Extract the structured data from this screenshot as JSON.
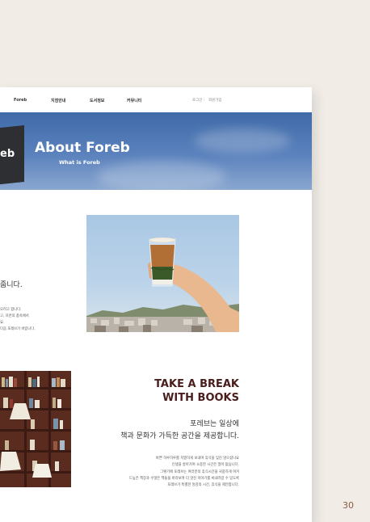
{
  "nav": {
    "items": [
      "Foreb",
      "지점안내",
      "도서정보",
      "커뮤니티"
    ],
    "login": "로그인",
    "signup": "회원가입"
  },
  "hero": {
    "sign_text": "eb",
    "title": "About Foreb",
    "subtitle": "What is Foreb"
  },
  "intro": {
    "heading_fragment": "줍니다.",
    "body_fragments": [
      "오려고 합니다.",
      "고, 자연의 품속에서",
      "요.",
      "다음 포레브가 바랍니다."
    ]
  },
  "break_section": {
    "title_line1": "TAKE A BREAK",
    "title_line2": "WITH BOOKS",
    "lead_line1": "포레브는 일상에",
    "lead_line2": "책과 문화가 가득한 공간을 제공합니다.",
    "body": [
      "바쁜 하루하루를 치열하게 보내며 휴식을 잊진 않으셨나요",
      "인생을 살아가며 소중한 시간은 많아 없습니다.",
      "그렇기에 포레브는 여러분의 휴식시간을 귀중하게 여겨",
      "드높은 책장과 수많은 책들을 바라보며  더 멋진 이야기를  써내려갈 수 있도록",
      "포레브가 특별한 멍강의 시간, 휴식을 제안합니다."
    ]
  },
  "page_number": "30"
}
